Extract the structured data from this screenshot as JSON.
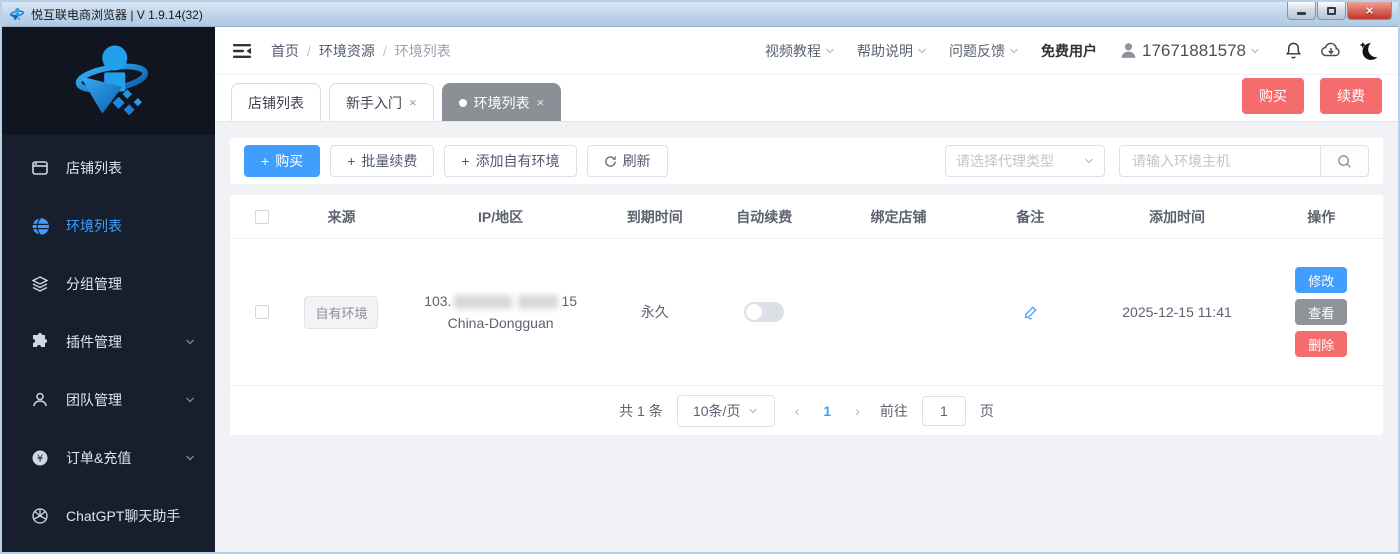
{
  "colors": {
    "primary": "#409eff",
    "danger": "#f56c6c",
    "info_gray": "#909399",
    "sidebar_bg": "#171e2d",
    "page_bg": "#f0f2f5",
    "active_tab_bg": "#8b8f96"
  },
  "icons": {
    "plus": "+",
    "close": "×",
    "multiply": "×"
  },
  "window": {
    "title": "悦互联电商浏览器 | V 1.9.14(32)"
  },
  "sidebar": {
    "items": [
      {
        "label": "店铺列表"
      },
      {
        "label": "环境列表"
      },
      {
        "label": "分组管理"
      },
      {
        "label": "插件管理"
      },
      {
        "label": "团队管理"
      },
      {
        "label": "订单&充值"
      },
      {
        "label": "ChatGPT聊天助手"
      }
    ]
  },
  "header": {
    "breadcrumb": {
      "sep": "/",
      "items": [
        "首页",
        "环境资源",
        "环境列表"
      ]
    },
    "menus": [
      "视频教程",
      "帮助说明",
      "问题反馈"
    ],
    "user_type": "免费用户",
    "account": "17671881578"
  },
  "tabs": {
    "items": [
      {
        "label": "店铺列表"
      },
      {
        "label": "新手入门"
      },
      {
        "label": "环境列表"
      }
    ],
    "buy": "购买",
    "renew": "续费"
  },
  "toolbar": {
    "buy": "购买",
    "batch_renew": "批量续费",
    "add_own_env": "添加自有环境",
    "refresh": "刷新",
    "proxy_select_placeholder": "请选择代理类型",
    "search_placeholder": "请输入环境主机"
  },
  "table": {
    "columns": [
      "来源",
      "IP/地区",
      "到期时间",
      "自动续费",
      "绑定店铺",
      "备注",
      "添加时间",
      "操作"
    ],
    "rows": [
      {
        "source_tag": "自有环境",
        "ip_prefix": "103.",
        "ip_suffix": "15",
        "region": "China-Dongguan",
        "expire": "永久",
        "auto_renew_on": false,
        "bound_shop": "",
        "added_time": "2025-12-15 11:41",
        "actions": [
          "修改",
          "查看",
          "删除"
        ]
      }
    ]
  },
  "pagination": {
    "total_text": "共 1 条",
    "page_size": "10条/页",
    "prev": "‹",
    "next": "›",
    "current_page": "1",
    "goto_label": "前往",
    "goto_value": "1",
    "page_label": "页"
  }
}
